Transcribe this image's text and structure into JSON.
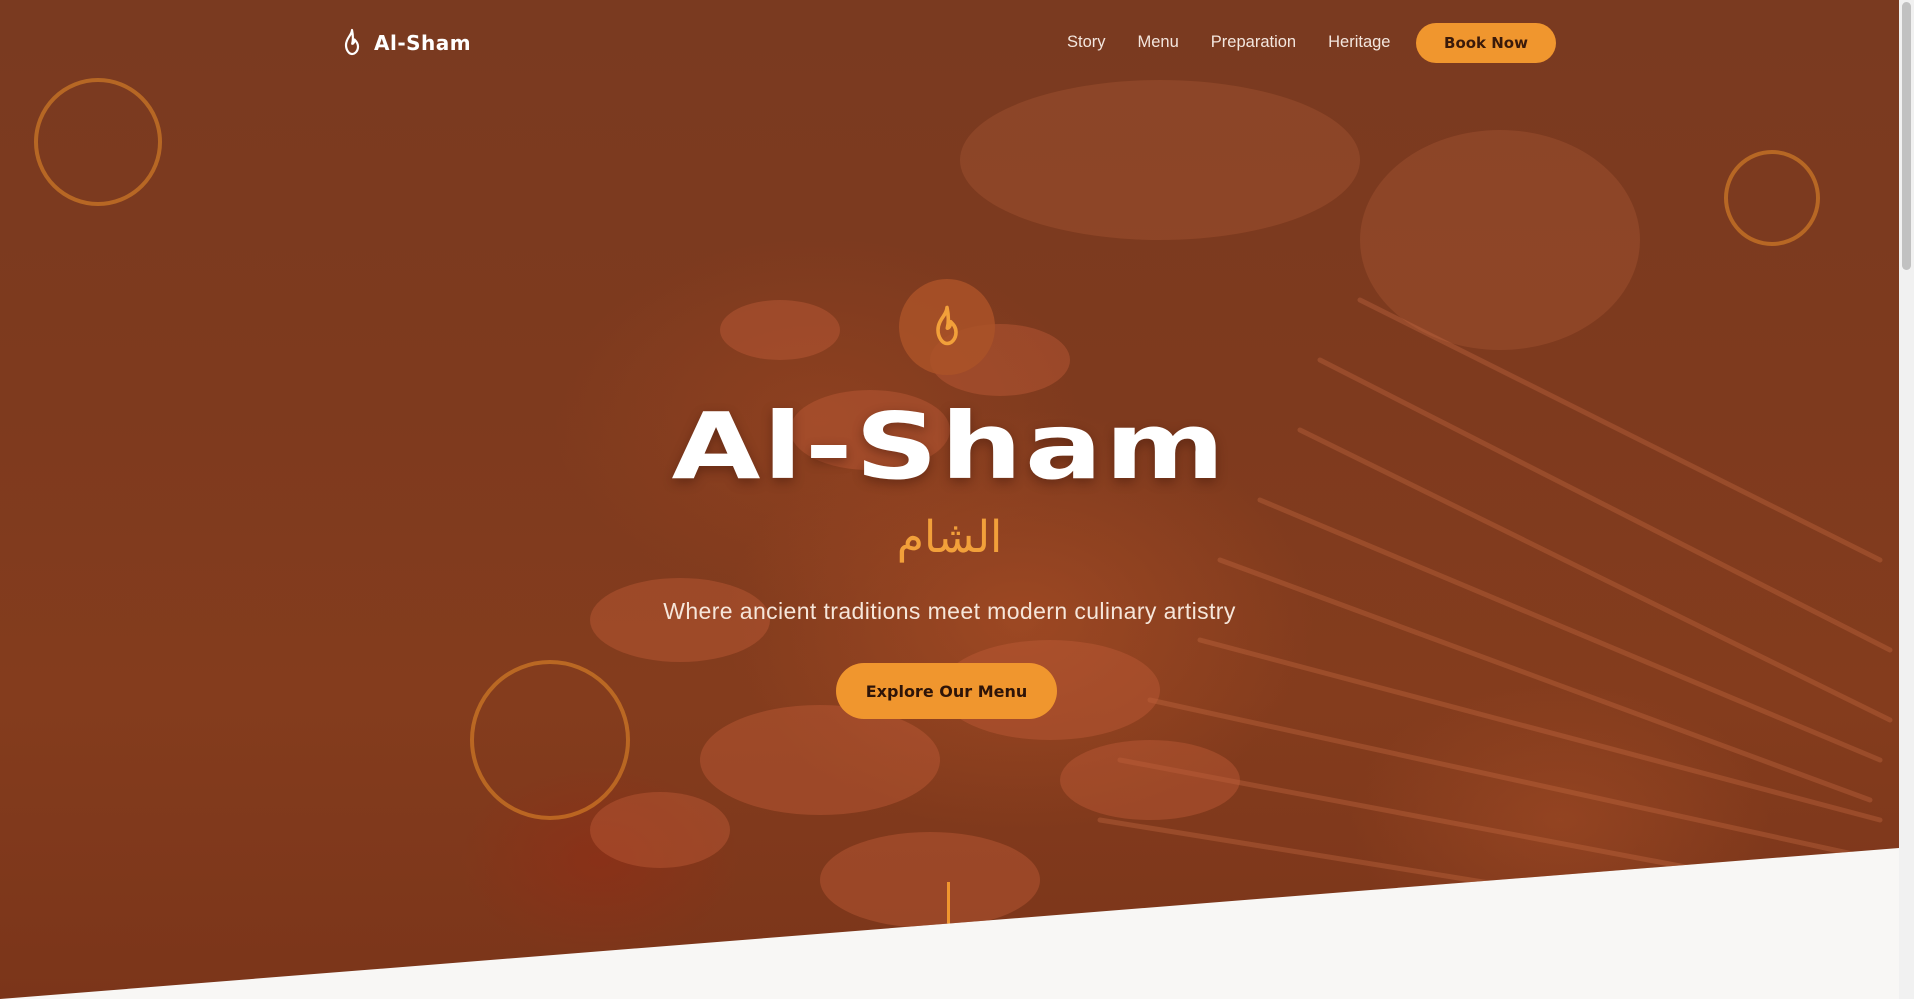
{
  "nav": {
    "brand": "Al-Sham",
    "links": [
      "Story",
      "Menu",
      "Preparation",
      "Heritage"
    ],
    "cta": "Book Now"
  },
  "hero": {
    "title": "Al-Sham",
    "arabic": "الشام",
    "tagline": "Where ancient traditions meet modern culinary artistry",
    "cta": "Explore Our Menu",
    "badge_icon": "flame-icon"
  },
  "colors": {
    "accent": "#f0962e",
    "hero_overlay": "#7e3a1e",
    "page_bg": "#f8f7f5"
  }
}
